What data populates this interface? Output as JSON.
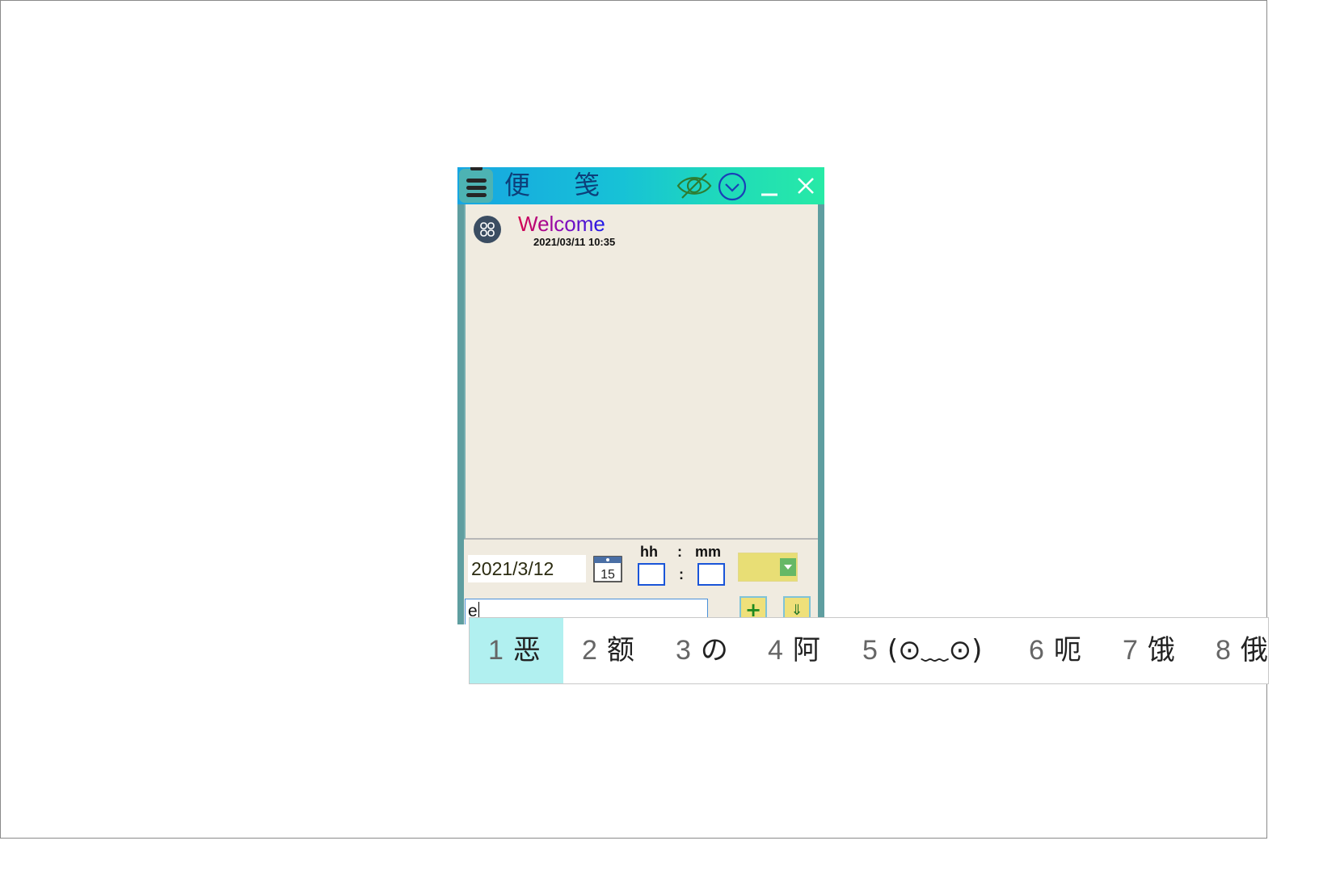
{
  "window": {
    "title": "便 笺"
  },
  "note": {
    "title": "Welcome",
    "time": "2021/03/11 10:35"
  },
  "controls": {
    "date": "2021/3/12",
    "calendar_day": "15",
    "hh_label": "hh",
    "mm_label": "mm",
    "colon": ":",
    "hour_value": "",
    "minute_value": "",
    "selected_color": "#e8de75",
    "input_text": "e",
    "add_label": "+",
    "save_label": "⇓"
  },
  "ime": {
    "candidates": [
      {
        "num": "1",
        "text": "恶"
      },
      {
        "num": "2",
        "text": "额"
      },
      {
        "num": "3",
        "text": "の"
      },
      {
        "num": "4",
        "text": "阿"
      },
      {
        "num": "5",
        "text": "(⊙﹏⊙)"
      },
      {
        "num": "6",
        "text": "呃"
      },
      {
        "num": "7",
        "text": "饿"
      },
      {
        "num": "8",
        "text": "俄"
      }
    ],
    "selected_index": 0
  },
  "colors": {
    "title_text": "#0d3f7a",
    "window_frame": "#5f9ea0",
    "note_background": "#f0ebe0",
    "ime_highlight": "#b1f0f0"
  }
}
